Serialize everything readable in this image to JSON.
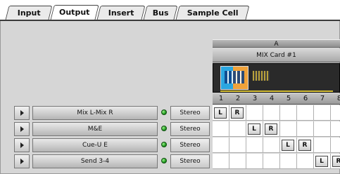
{
  "tabs": [
    {
      "label": "Input"
    },
    {
      "label": "Output"
    },
    {
      "label": "Insert"
    },
    {
      "label": "Bus"
    },
    {
      "label": "Sample Cell"
    }
  ],
  "active_tab": "Output",
  "card": {
    "letter": "A",
    "name": "MIX Card #1"
  },
  "columns": [
    "1",
    "2",
    "3",
    "4",
    "5",
    "6",
    "7",
    "8"
  ],
  "rows": [
    {
      "name": "Mix L-Mix R",
      "mode": "Stereo",
      "left_col": 1,
      "right_col": 2,
      "left_label": "L",
      "right_label": "R"
    },
    {
      "name": "M&E",
      "mode": "Stereo",
      "left_col": 3,
      "right_col": 4,
      "left_label": "L",
      "right_label": "R"
    },
    {
      "name": "Cue-U E",
      "mode": "Stereo",
      "left_col": 5,
      "right_col": 6,
      "left_label": "L",
      "right_label": "R"
    },
    {
      "name": "Send 3-4",
      "mode": "Stereo",
      "left_col": 7,
      "right_col": 8,
      "left_label": "L",
      "right_label": "R"
    }
  ],
  "colors": {
    "led_on": "#1f9a1f",
    "display_bg": "#2a2a2a"
  }
}
